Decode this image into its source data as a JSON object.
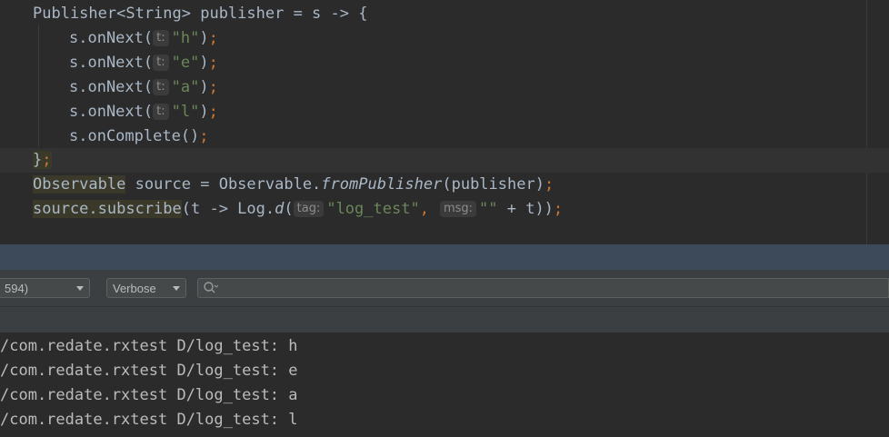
{
  "editor": {
    "line1": {
      "a": "Publisher<String> publisher = s -> {"
    },
    "onNext": [
      {
        "prefix": "s.onNext(",
        "hint": "t:",
        "arg": "\"h\"",
        "close": ")",
        "semi": ";"
      },
      {
        "prefix": "s.onNext(",
        "hint": "t:",
        "arg": "\"e\"",
        "close": ")",
        "semi": ";"
      },
      {
        "prefix": "s.onNext(",
        "hint": "t:",
        "arg": "\"a\"",
        "close": ")",
        "semi": ";"
      },
      {
        "prefix": "s.onNext(",
        "hint": "t:",
        "arg": "\"l\"",
        "close": ")",
        "semi": ";"
      }
    ],
    "onComplete": {
      "text": "s.onComplete()",
      "semi": ";"
    },
    "closeLambda": {
      "brace": "}",
      "semi": ";"
    },
    "observableLine": {
      "type": "Observable",
      "mid": " source = Observable.",
      "method": "fromPublisher",
      "args": "(publisher)",
      "semi": ";"
    },
    "subscribeLine": {
      "hl": "source.subscribe",
      "a": "(t -> Log.",
      "method": "d",
      "paren": "(",
      "hint_tag": "tag:",
      "tag_val": "\"log_test\"",
      "comma": ",",
      "hint_msg": "msg:",
      "msg_val": "\"\"",
      "rest": " + t))",
      "semi": ";"
    }
  },
  "logcat": {
    "process_dropdown": "594)",
    "level_dropdown": "Verbose",
    "search_placeholder": "",
    "lines": [
      "/com.redate.rxtest D/log_test: h",
      "/com.redate.rxtest D/log_test: e",
      "/com.redate.rxtest D/log_test: a",
      "/com.redate.rxtest D/log_test: l"
    ]
  },
  "icons": {
    "search": "search-icon",
    "dropdown": "chevron-down-icon"
  },
  "colors": {
    "editor_bg": "#2b2b2b",
    "keyword": "#cc7832",
    "string": "#6a8759",
    "text": "#a9b7c6",
    "toolbar_bg": "#3c3f41",
    "bar_blue": "#3c4a5a"
  }
}
